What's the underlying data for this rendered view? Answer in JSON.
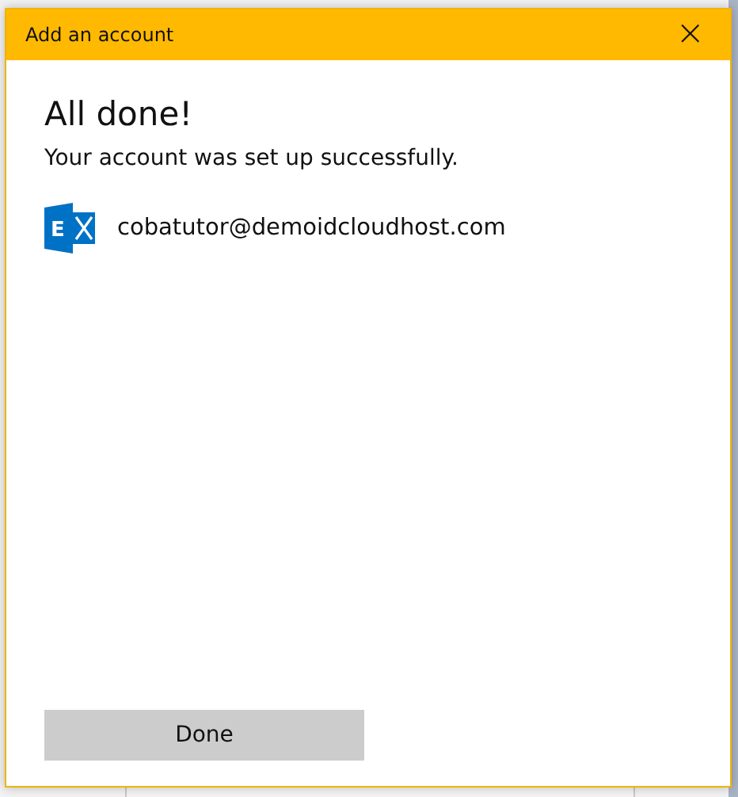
{
  "dialog": {
    "title": "Add an account",
    "close": "×",
    "heading": "All done!",
    "message": "Your account was set up successfully.",
    "account": {
      "icon_letter": "E",
      "email": "cobatutor@demoidcloudhost.com"
    },
    "buttons": [
      {
        "label": "Done",
        "kind": "primary"
      }
    ]
  }
}
